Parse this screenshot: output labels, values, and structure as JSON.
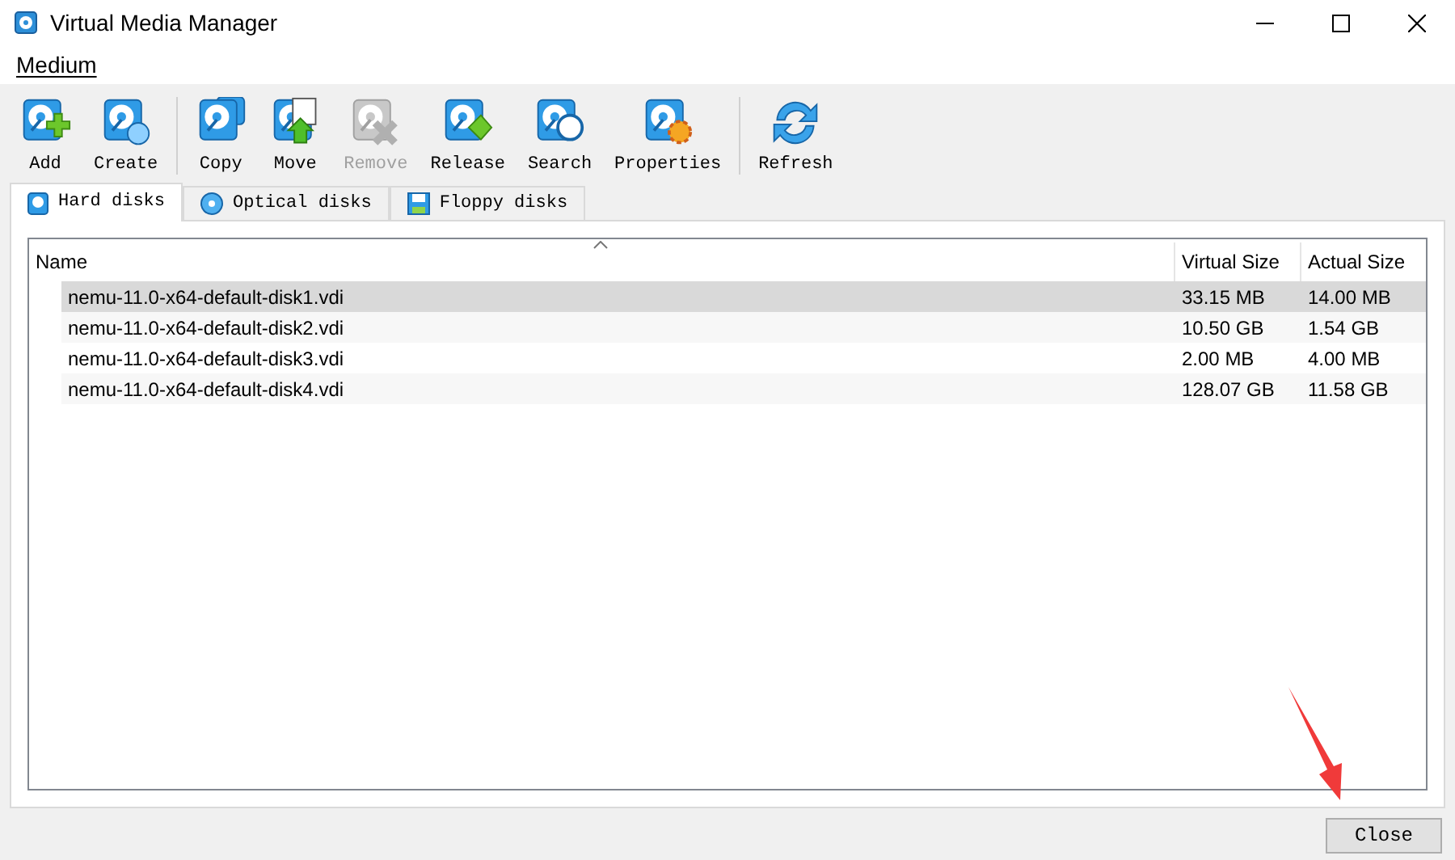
{
  "window": {
    "title": "Virtual Media Manager"
  },
  "menu": [
    "Medium"
  ],
  "toolbar": [
    {
      "label": "Add",
      "disabled": false
    },
    {
      "label": "Create",
      "disabled": false
    },
    {
      "label": "Copy",
      "disabled": false
    },
    {
      "label": "Move",
      "disabled": false
    },
    {
      "label": "Remove",
      "disabled": true
    },
    {
      "label": "Release",
      "disabled": false
    },
    {
      "label": "Search",
      "disabled": false
    },
    {
      "label": "Properties",
      "disabled": false
    },
    {
      "label": "Refresh",
      "disabled": false
    }
  ],
  "tabs": [
    {
      "label": "Hard disks",
      "selected": true
    },
    {
      "label": "Optical disks",
      "selected": false
    },
    {
      "label": "Floppy disks",
      "selected": false
    }
  ],
  "table": {
    "columns": [
      "Name",
      "Virtual Size",
      "Actual Size"
    ],
    "rows": [
      {
        "cells": [
          "nemu-11.0-x64-default-disk1.vdi",
          "33.15 MB",
          "14.00 MB"
        ],
        "selected": true
      },
      {
        "cells": [
          "nemu-11.0-x64-default-disk2.vdi",
          "10.50 GB",
          "1.54 GB"
        ],
        "selected": false
      },
      {
        "cells": [
          "nemu-11.0-x64-default-disk3.vdi",
          "2.00 MB",
          "4.00 MB"
        ],
        "selected": false
      },
      {
        "cells": [
          "nemu-11.0-x64-default-disk4.vdi",
          "128.07 GB",
          "11.58 GB"
        ],
        "selected": false
      }
    ]
  },
  "buttons": [
    "Close"
  ]
}
